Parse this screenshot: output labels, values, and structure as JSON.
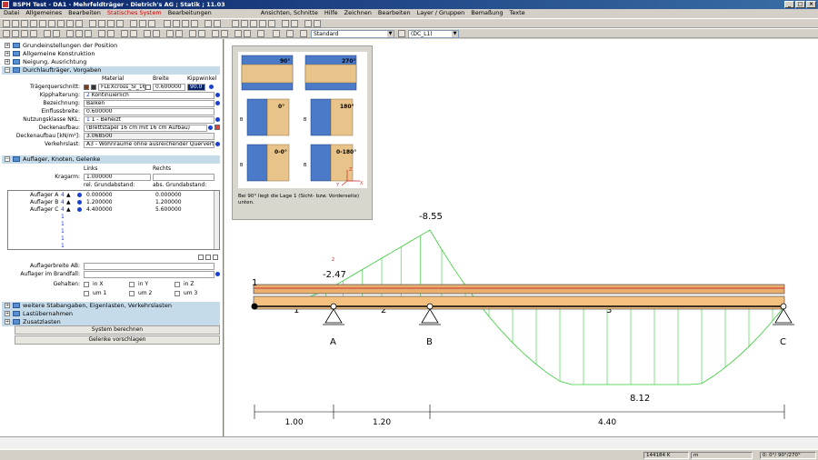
{
  "window": {
    "title": "BSPH Test - DA1 - Mehrfeldträger - Dietrich's AG ; Statik ; 11.03",
    "buttons": [
      "_",
      "□",
      "×"
    ]
  },
  "menu": [
    "Datei",
    "Allgemeines",
    "Bearbeiten",
    "Statisches System",
    "Bearbeitungen",
    "Ansichten, Schnitte",
    "Hilfe",
    "Zeichnen",
    "Bearbeiten",
    "Layer / Gruppen",
    "Bemaßung",
    "Texte"
  ],
  "menu_active": 3,
  "toolbar": {
    "style_combo": "Standard",
    "layer_combo": "(DC_L1)"
  },
  "sections": {
    "grund": "Grundeinstellungen der Position",
    "allg": "Allgemeine Konstruktion",
    "neig": "Neigung, Ausrichtung",
    "durch": "Durchlaufträger, Vorgaben",
    "auflager": "Auflager, Knoten, Gelenke",
    "weitere": "weitere Stabangaben, Eigenlasten, Verkehrslasten",
    "lastueb": "Lastübernahmen",
    "zusatz": "Zusatzlasten"
  },
  "durchlauf": {
    "col_material": "Material",
    "col_breite": "Breite",
    "col_kipp": "Kippwinkel",
    "traeger_label": "Trägerquerschnitt:",
    "traeger_material": "FLEXcross_SI_16",
    "traeger_breite": "0.600000",
    "traeger_kipp": "90.0",
    "kipp_label": "Kipphalterung:",
    "kipp_val": "Kontinuierlich",
    "kipp_num": "2",
    "bez_label": "Bezeichnung:",
    "bez_val": "Balken",
    "einfluss_label": "Einflussbreite:",
    "einfluss_val": "0.600000",
    "nkl_label": "Nutzungsklasse NKL:",
    "nkl_num": "1",
    "nkl_val": "1 - Beheizt",
    "deck_label": "Deckenaufbau:",
    "deck_val": "(Brettstapel 16 cm mit 16 cm Aufbau)",
    "deckkn_label": "Deckenaufbau [kN/m²]:",
    "deckkn_val": "3.068500",
    "verkehr_label": "Verkehrslast:",
    "verkehr_val": "A3 - Wohnräume ohne ausreichender Querverteil"
  },
  "auflager": {
    "col_links": "Links",
    "col_rechts": "Rechts",
    "kragarm_label": "Kragarm:",
    "kragarm_val": "1.000000",
    "col_rel": "rel. Grundabstand:",
    "col_abs": "abs. Grundabstand:",
    "rows": [
      {
        "name": "Auflager A",
        "num": "4",
        "rel": "0.000000",
        "abs": "0.000000"
      },
      {
        "name": "Auflager B",
        "num": "4",
        "rel": "1.200000",
        "abs": "1.200000"
      },
      {
        "name": "Auflager C",
        "num": "4",
        "rel": "4.400000",
        "abs": "5.600000"
      }
    ],
    "empty_nums": [
      "1",
      "1",
      "1",
      "1",
      "1"
    ],
    "breite_label": "Auflagerbreite AB:",
    "brand_label": "Auflager im Brandfall:",
    "gehalten_label": "Gehalten:",
    "checks": [
      "in X",
      "in Y",
      "in Z",
      "um 1",
      "um 2",
      "um 3"
    ]
  },
  "buttons": {
    "system": "System berechnen",
    "gelenke": "Gelenke vorschlagen"
  },
  "info": {
    "caption": "Bei 90° liegt die Lage 1 (Sicht- bzw. Vorderseite) unten.",
    "angles": [
      "90°",
      "270°",
      "0°",
      "180°",
      "0-0°",
      "0-180°"
    ],
    "side_label": "B",
    "axes": [
      "X",
      "Y",
      "Z"
    ]
  },
  "diagram": {
    "z_label": "z",
    "node_label": "1",
    "supports": [
      "A",
      "B",
      "C"
    ],
    "fields": [
      "1",
      "2",
      "3"
    ],
    "moments": [
      "-2.47",
      "-8.55",
      "8.12"
    ],
    "dims": [
      "1.00",
      "1.20",
      "4.40"
    ]
  },
  "status": {
    "coord": "144184 K",
    "unit": "m",
    "angles": "0: 0°/ 90°/270°"
  },
  "colors": {
    "moment": "#33cc33",
    "beam_top": "#e8b070",
    "beam_red": "#cc3030",
    "title_grad": "#0a246a"
  }
}
